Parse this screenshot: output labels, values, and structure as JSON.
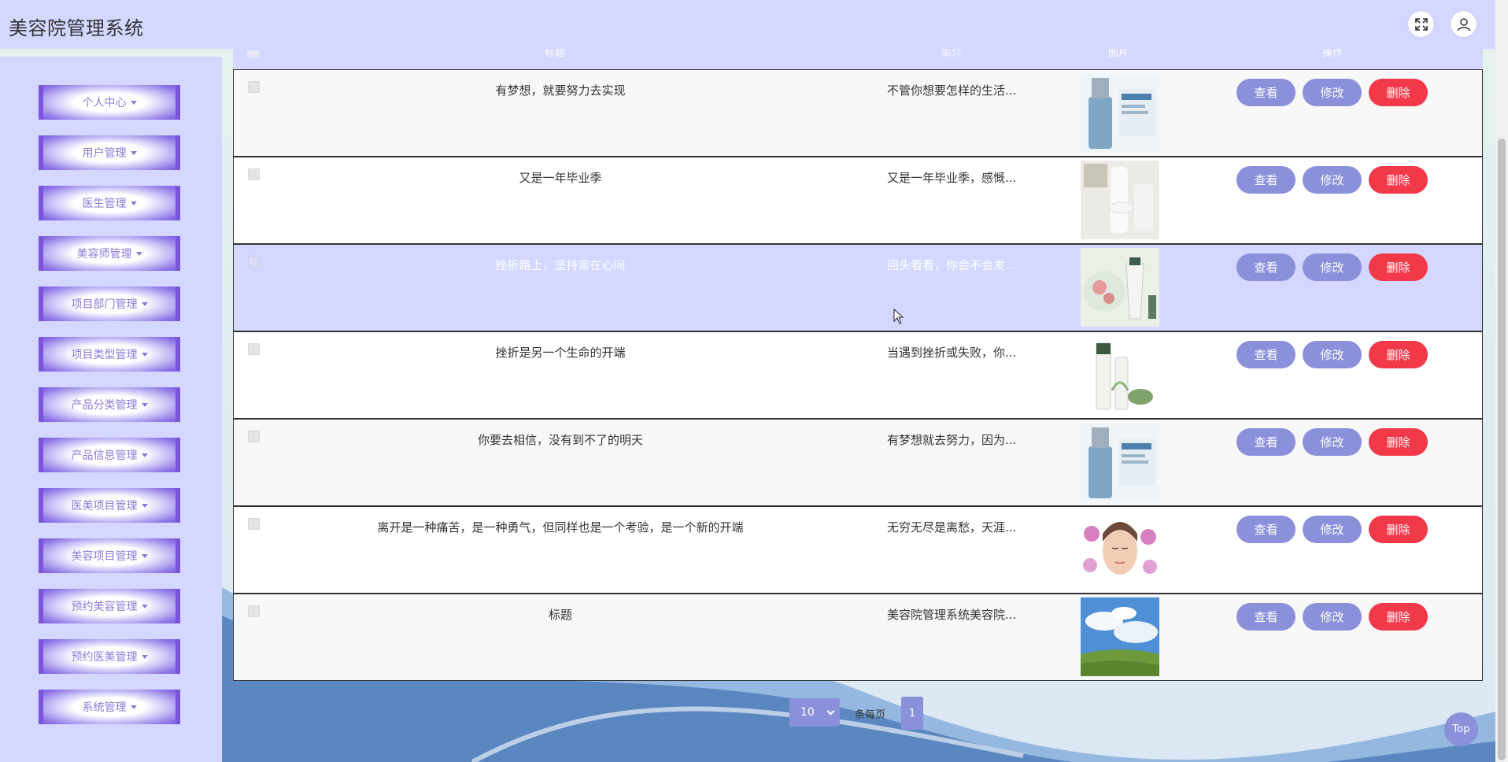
{
  "header": {
    "app_title": "美容院管理系统"
  },
  "sidebar": {
    "items": [
      {
        "label": "个人中心"
      },
      {
        "label": "用户管理"
      },
      {
        "label": "医生管理"
      },
      {
        "label": "美容师管理"
      },
      {
        "label": "项目部门管理"
      },
      {
        "label": "项目类型管理"
      },
      {
        "label": "产品分类管理"
      },
      {
        "label": "产品信息管理"
      },
      {
        "label": "医美项目管理"
      },
      {
        "label": "美容项目管理"
      },
      {
        "label": "预约美容管理"
      },
      {
        "label": "预约医美管理"
      },
      {
        "label": "系统管理"
      }
    ]
  },
  "table": {
    "columns": [
      "标题",
      "简介",
      "图片",
      "操作"
    ],
    "rows": [
      {
        "title": "有梦想，就要努力去实现",
        "intro": "不管你想要怎样的生活...",
        "image": "serum-bottle-blue"
      },
      {
        "title": "又是一年毕业季",
        "intro": "又是一年毕业季，感慨...",
        "image": "white-cosmetics"
      },
      {
        "title": "挫折路上，坚持常在心间",
        "intro": "回头看看，你会不会发...",
        "image": "cream-tube-flowers"
      },
      {
        "title": "挫折是另一个生命的开端",
        "intro": "当遇到挫折或失败，你...",
        "image": "green-skincare-set"
      },
      {
        "title": "你要去相信，没有到不了的明天",
        "intro": "有梦想就去努力，因为...",
        "image": "serum-bottle-blue"
      },
      {
        "title": "离开是一种痛苦，是一种勇气，但同样也是一个考验，是一个新的开端",
        "intro": "无穷无尽是离愁，天涯...",
        "image": "face-orchids"
      },
      {
        "title": "标题",
        "intro": "美容院管理系统美容院...",
        "image": "sky-meadow"
      }
    ],
    "actions": {
      "view": "查看",
      "edit": "修改",
      "delete": "删除"
    }
  },
  "pagination": {
    "page_size": "10",
    "per_page_label": "条每页",
    "current_page": "1"
  },
  "top_button": "Top",
  "colors": {
    "accent": "#8b90db",
    "header_bg": "#d4d7ff",
    "danger": "#f2394a",
    "menu_border": "#7a55dc"
  }
}
